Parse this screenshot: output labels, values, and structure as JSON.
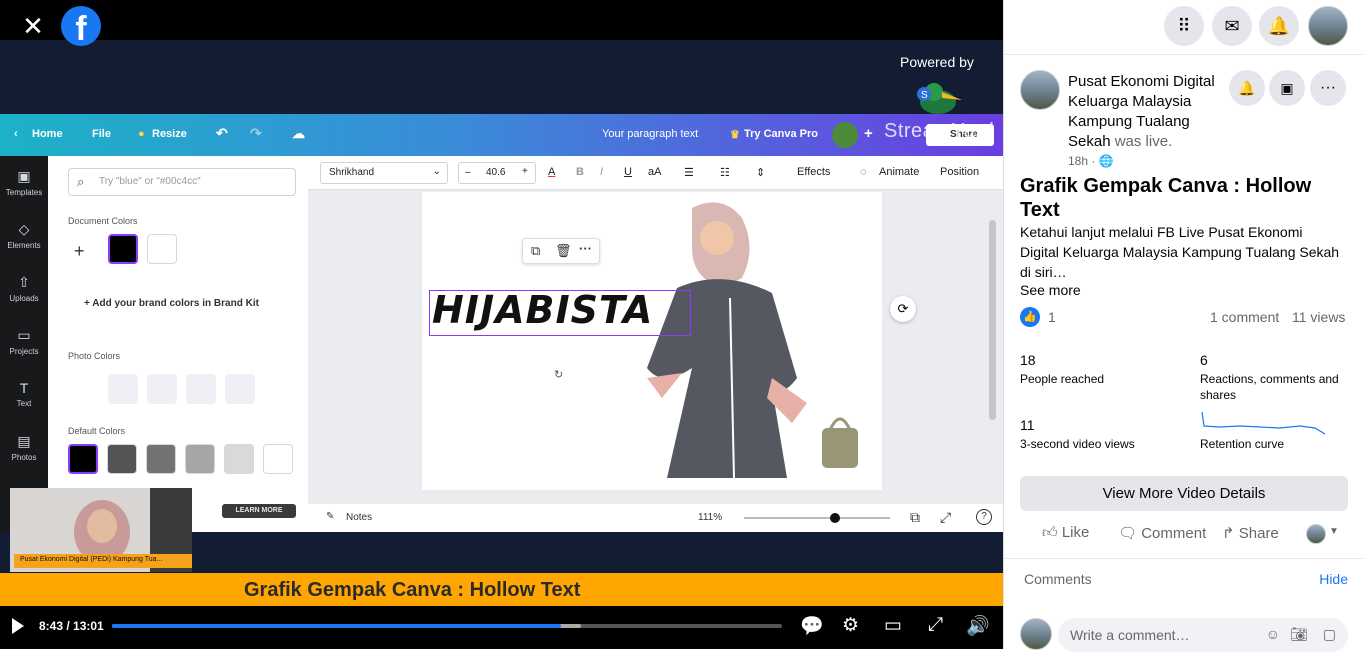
{
  "viewer": {
    "close_glyph": "✕",
    "logo_letter": "f",
    "powered_by": "Powered by",
    "streamyard_text": "StreamYard",
    "canva": {
      "home": "Home",
      "file": "File",
      "resize": "Resize",
      "paragraph": "Your paragraph text",
      "try_pro": "Try Canva Pro",
      "share": "Share",
      "rail": [
        "Templates",
        "Elements",
        "Uploads",
        "Projects",
        "Text",
        "Photos"
      ],
      "search_placeholder": "Try \"blue\" or \"#00c4cc\"",
      "document_colors": "Document Colors",
      "brand_colors": "Add your brand colors in Brand Kit",
      "photo_colors": "Photo Colors",
      "default_colors": "Default Colors",
      "learn_more": "LEARN MORE",
      "font": "Shrikhand",
      "font_size": "40.6",
      "effects": "Effects",
      "animate": "Animate",
      "position": "Position",
      "canvas_text": "HIJABISTA",
      "notes": "Notes",
      "zoom": "111%",
      "zoom_fraction": 0.62
    },
    "webcam_caption": "Pusat Ekonomi Digital (PEDi) Kampung Tua...",
    "banner": "Grafik Gempak Canva : Hollow Text",
    "time": "8:43 / 13:01",
    "progress_fraction": 0.67,
    "buffered_fraction": 0.7
  },
  "sidebar": {
    "page_name": "Pusat Ekonomi Digital Keluarga Malaysia Kampung Tualang Sekah",
    "was_live": "was live.",
    "time_ago": "18h ·",
    "title": "Grafik Gempak Canva : Hollow Text",
    "body": "Ketahui lanjut melalui FB Live Pusat Ekonomi Digital Keluarga Malaysia Kampung Tualang Sekah di siri…",
    "see_more": "See more",
    "like_count": "1",
    "comments": "1 comment",
    "views": "11 views",
    "insights": {
      "reached_num": "18",
      "reached_lbl": "People reached",
      "reactions_num": "6",
      "reactions_lbl": "Reactions, comments and shares",
      "views3_num": "11",
      "views3_lbl": "3-second video views",
      "retention_lbl": "Retention curve"
    },
    "view_more": "View More Video Details",
    "like": "Like",
    "comment": "Comment",
    "share": "Share",
    "comments_label": "Comments",
    "hide": "Hide",
    "write_placeholder": "Write a comment…"
  }
}
